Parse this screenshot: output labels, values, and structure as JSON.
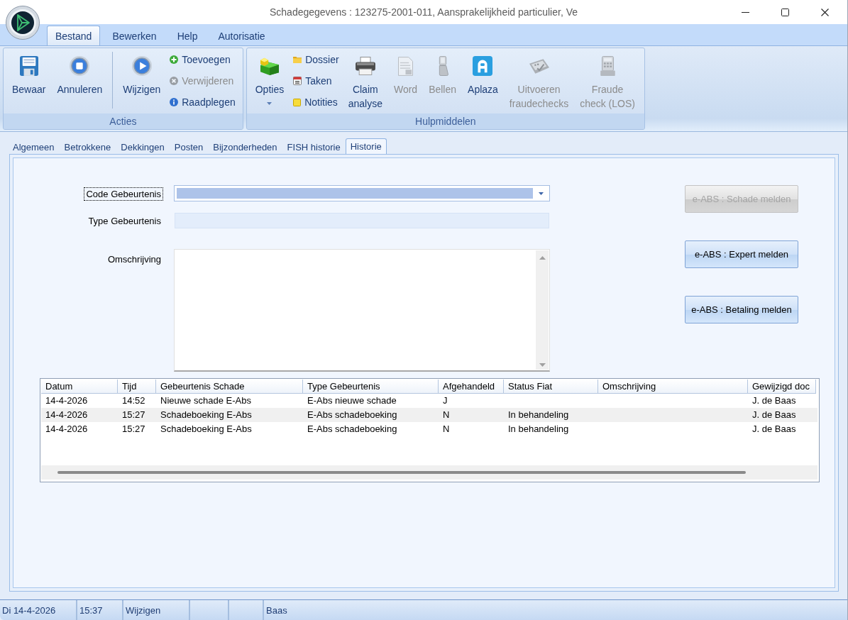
{
  "window": {
    "title": "Schadegegevens : 123275-2001-011, Aansprakelijkheid particulier, Ve"
  },
  "ribbon_tabs": [
    {
      "label": "Bestand",
      "selected": true
    },
    {
      "label": "Bewerken",
      "selected": false
    },
    {
      "label": "Help",
      "selected": false
    },
    {
      "label": "Autorisatie",
      "selected": false
    }
  ],
  "ribbon_groups": [
    {
      "label": "Acties",
      "items": [
        {
          "kind": "large",
          "lines": [
            "Bewaar"
          ],
          "disabled": false,
          "dropdown": false
        },
        {
          "kind": "large",
          "lines": [
            "Annuleren"
          ],
          "disabled": false,
          "dropdown": false
        },
        {
          "kind": "separator"
        },
        {
          "kind": "large",
          "lines": [
            "Wijzigen"
          ],
          "disabled": false,
          "dropdown": false
        },
        {
          "kind": "stack",
          "buttons": [
            {
              "label": "Toevoegen",
              "disabled": false
            },
            {
              "label": "Verwijderen",
              "disabled": true
            },
            {
              "label": "Raadplegen",
              "disabled": false
            }
          ]
        }
      ]
    },
    {
      "label": "Hulpmiddelen",
      "items": [
        {
          "kind": "large",
          "lines": [
            "Opties"
          ],
          "disabled": false,
          "dropdown": true
        },
        {
          "kind": "stack",
          "buttons": [
            {
              "label": "Dossier",
              "disabled": false
            },
            {
              "label": "Taken",
              "disabled": false
            },
            {
              "label": "Notities",
              "disabled": false
            }
          ]
        },
        {
          "kind": "large",
          "lines": [
            "Claim",
            "analyse"
          ],
          "disabled": false,
          "dropdown": false
        },
        {
          "kind": "large",
          "lines": [
            "Word"
          ],
          "disabled": true,
          "dropdown": false
        },
        {
          "kind": "large",
          "lines": [
            "Bellen"
          ],
          "disabled": true,
          "dropdown": false
        },
        {
          "kind": "large",
          "lines": [
            "Aplaza"
          ],
          "disabled": false,
          "dropdown": false
        },
        {
          "kind": "large",
          "lines": [
            "Uitvoeren",
            "fraudechecks"
          ],
          "disabled": true,
          "dropdown": false
        },
        {
          "kind": "large",
          "lines": [
            "Fraude",
            "check (LOS)"
          ],
          "disabled": true,
          "dropdown": false
        }
      ]
    }
  ],
  "main_tabs": [
    {
      "label": "Algemeen",
      "selected": false
    },
    {
      "label": "Betrokkene",
      "selected": false
    },
    {
      "label": "Dekkingen",
      "selected": false
    },
    {
      "label": "Posten",
      "selected": false
    },
    {
      "label": "Bijzonderheden",
      "selected": false
    },
    {
      "label": "FISH historie",
      "selected": false
    },
    {
      "label": "Historie",
      "selected": true
    }
  ],
  "form": {
    "fields": [
      {
        "kind": "combo",
        "label": "Code Gebeurtenis",
        "focused": true
      },
      {
        "kind": "readonly",
        "label": "Type Gebeurtenis",
        "focused": false
      },
      {
        "kind": "textarea",
        "label": "Omschrijving",
        "focused": false
      }
    ],
    "actions": [
      {
        "label": "e-ABS : Schade melden",
        "disabled": true
      },
      {
        "label": "e-ABS : Expert melden",
        "disabled": false
      },
      {
        "label": "e-ABS : Betaling melden",
        "disabled": false
      }
    ]
  },
  "table": {
    "columns": [
      "Datum",
      "Tijd",
      "Gebeurtenis Schade",
      "Type Gebeurtenis",
      "Afgehandeld",
      "Status Fiat",
      "Omschrijving",
      "Gewijzigd doc"
    ],
    "rows": [
      {
        "datum": "14-4-2026",
        "tijd": "14:52",
        "gebeurtenis_schade": "Nieuwe schade E-Abs",
        "type_gebeurtenis": "E-Abs nieuwe schade",
        "afgehandeld": "J",
        "column_8": "J. de Baas"
      },
      {
        "datum": "14-4-2026",
        "tijd": "15:27",
        "gebeurtenis_schade": "Schadeboeking E-Abs",
        "type_gebeurtenis": "E-Abs schadeboeking",
        "afgehandeld": "N",
        "status_fiat": "In behandeling",
        "column_8": "J. de Baas"
      },
      {
        "datum": "14-4-2026",
        "tijd": "15:27",
        "gebeurtenis_schade": "Schadeboeking E-Abs",
        "type_gebeurtenis": "E-Abs schadeboeking",
        "afgehandeld": "N",
        "status_fiat": "In behandeling",
        "column_8": "J. de Baas"
      }
    ]
  },
  "status_bar": {
    "date": "Di 14-4-2026",
    "time": "15:37",
    "mode": "Wijzigen",
    "user": "Baas"
  }
}
